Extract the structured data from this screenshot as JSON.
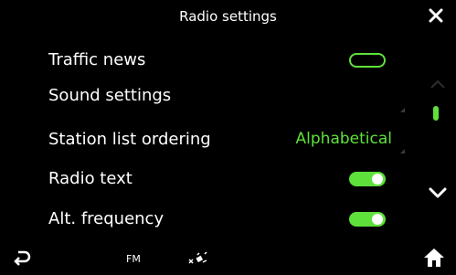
{
  "header": {
    "title": "Radio settings"
  },
  "rows": [
    {
      "label": "Traffic news",
      "toggle": "off"
    },
    {
      "label": "Sound settings"
    },
    {
      "label": "Station list ordering",
      "value": "Alphabetical"
    },
    {
      "label": "Radio text",
      "toggle": "on"
    },
    {
      "label": "Alt. frequency",
      "toggle": "on"
    }
  ],
  "footer": {
    "source": "FM"
  },
  "colors": {
    "accent": "#5ee13a",
    "background": "#000000",
    "text": "#ffffff"
  },
  "icons": {
    "close": "close-icon",
    "back": "back-arrow-icon",
    "satellite": "satellite-icon",
    "home": "home-icon",
    "scroll_up": "chevron-up-icon",
    "scroll_down": "chevron-down-icon"
  }
}
